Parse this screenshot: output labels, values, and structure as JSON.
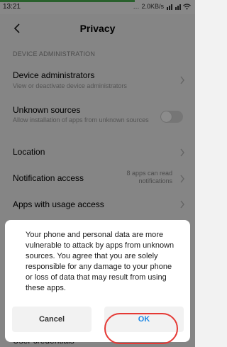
{
  "status_bar": {
    "time": "13:21",
    "speed": "2.0KB/s",
    "progress_percent": 69
  },
  "header": {
    "title": "Privacy"
  },
  "section_label": "DEVICE ADMINISTRATION",
  "rows": [
    {
      "title": "Device administrators",
      "subtitle": "View or deactivate device administrators"
    },
    {
      "title": "Unknown sources",
      "subtitle": "Allow installation of apps from unknown sources",
      "toggle_on": false
    },
    {
      "title": "Location"
    },
    {
      "title": "Notification access",
      "aside": "8 apps can read notifications"
    },
    {
      "title": "Apps with usage access"
    }
  ],
  "background_peek": "User credentials",
  "dialog": {
    "message": "Your phone and personal data are more vulnerable to attack by apps from unknown sources. You agree that you are solely responsible for any damage to your phone or loss of data that may result from using these apps.",
    "cancel_label": "Cancel",
    "ok_label": "OK"
  },
  "colors": {
    "accent": "#1e88e5",
    "highlight_ring": "#e53935"
  }
}
